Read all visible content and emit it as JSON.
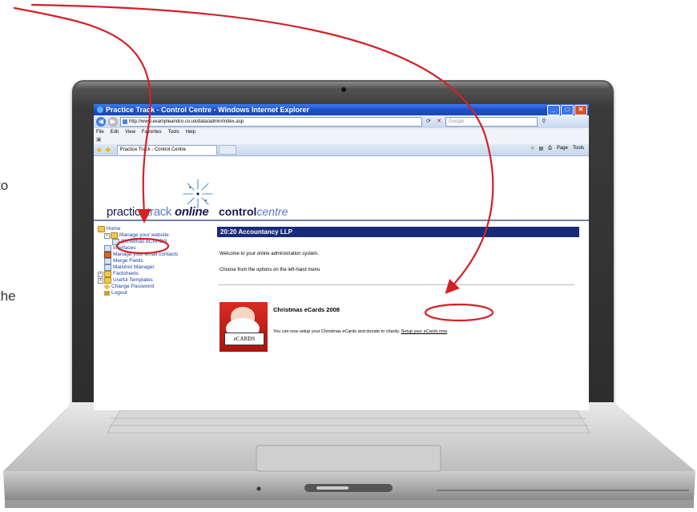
{
  "side_text": [
    "to",
    "the"
  ],
  "browser": {
    "window_title": "Practice Track - Control Centre - Windows Internet Explorer",
    "address": "http://www.exampleandco.co.uk/data/admin/index.asp",
    "search_placeholder": "Google",
    "menu": [
      "File",
      "Edit",
      "View",
      "Favorites",
      "Tools",
      "Help"
    ],
    "tab_title": "Practice Track - Control Centre",
    "commands": [
      "Page",
      "Tools"
    ]
  },
  "logos": {
    "brand_part1": "practice",
    "brand_part2": "track",
    "brand_part3": "online",
    "cc_part1": "control",
    "cc_part2": "centre"
  },
  "sidebar": {
    "items": [
      {
        "label": "Home"
      },
      {
        "label": "Manage your website"
      },
      {
        "label": "Christmas eCARDS"
      },
      {
        "label": "Interfaces"
      },
      {
        "label": "Manage your email contacts"
      },
      {
        "label": "Merge Fields"
      },
      {
        "label": "Mailshot Manager"
      },
      {
        "label": "Factsheets"
      },
      {
        "label": "Useful Templates"
      },
      {
        "label": "Change Password"
      },
      {
        "label": "Logout"
      }
    ]
  },
  "main": {
    "heading": "20:20 Accountancy LLP",
    "welcome": "Welcome to your online administration system.",
    "choose": "Choose from the options on the left-hand menu",
    "ecard_title": "Christmas eCards 2008",
    "ecard_desc": "You can now setup your Christmas eCards and donate to charity.",
    "ecard_link": "Setup your eCards now",
    "ecard_sign": "eCARDS"
  },
  "colors": {
    "annotation": "#d42027",
    "heading_bar": "#1a2a7a",
    "title_bar": "#1e4fc4"
  }
}
